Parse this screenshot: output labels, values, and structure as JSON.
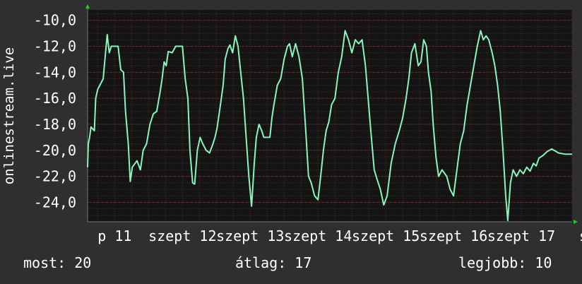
{
  "chart_data": {
    "type": "line",
    "ylabel": "onlinestream.live",
    "ylim": [
      -25.5,
      -9.2
    ],
    "yticks": [
      "-10,0",
      "-12,0",
      "-14,0",
      "-16,0",
      "-18,0",
      "-20,0",
      "-22,0",
      "-24,0"
    ],
    "ytick_values": [
      -10,
      -12,
      -14,
      -16,
      -18,
      -20,
      -22,
      -24
    ],
    "xlim": [
      10.6,
      17.75
    ],
    "xticks": [
      {
        "label": "p 11",
        "value": 11
      },
      {
        "label": "szept 12",
        "value": 12
      },
      {
        "label": "szept 13",
        "value": 13
      },
      {
        "label": "szept 14",
        "value": 14
      },
      {
        "label": "szept 15",
        "value": 15
      },
      {
        "label": "szept 16",
        "value": 16
      },
      {
        "label": "szept 17",
        "value": 17
      },
      {
        "label": "sz",
        "value": 17.98
      }
    ],
    "grid": true,
    "colors": {
      "background": "#2f2f2f",
      "plot": "#141414",
      "line": "#88f5bd",
      "grid": "#4a2d2d",
      "arrow": "#22cc22"
    },
    "series": [
      {
        "values": [
          [
            10.6,
            -21.3
          ],
          [
            10.61,
            -19.5
          ],
          [
            10.63,
            -19.0
          ],
          [
            10.65,
            -18.2
          ],
          [
            10.7,
            -18.5
          ],
          [
            10.72,
            -16.0
          ],
          [
            10.75,
            -15.3
          ],
          [
            10.8,
            -14.8
          ],
          [
            10.83,
            -14.5
          ],
          [
            10.86,
            -12.8
          ],
          [
            10.89,
            -11.1
          ],
          [
            10.92,
            -12.5
          ],
          [
            10.95,
            -12.0
          ],
          [
            11.05,
            -12.0
          ],
          [
            11.09,
            -13.8
          ],
          [
            11.13,
            -14.0
          ],
          [
            11.16,
            -17.0
          ],
          [
            11.2,
            -19.5
          ],
          [
            11.23,
            -22.4
          ],
          [
            11.26,
            -21.3
          ],
          [
            11.3,
            -21.0
          ],
          [
            11.33,
            -20.8
          ],
          [
            11.38,
            -21.5
          ],
          [
            11.42,
            -20.0
          ],
          [
            11.47,
            -19.5
          ],
          [
            11.52,
            -18.0
          ],
          [
            11.57,
            -17.2
          ],
          [
            11.62,
            -17.0
          ],
          [
            11.67,
            -15.5
          ],
          [
            11.7,
            -14.5
          ],
          [
            11.73,
            -13.2
          ],
          [
            11.76,
            -13.5
          ],
          [
            11.79,
            -12.4
          ],
          [
            11.85,
            -12.5
          ],
          [
            11.9,
            -12.0
          ],
          [
            12.0,
            -12.0
          ],
          [
            12.04,
            -14.5
          ],
          [
            12.08,
            -16.0
          ],
          [
            12.11,
            -20.0
          ],
          [
            12.15,
            -22.5
          ],
          [
            12.18,
            -22.6
          ],
          [
            12.22,
            -20.0
          ],
          [
            12.26,
            -19.0
          ],
          [
            12.3,
            -19.5
          ],
          [
            12.35,
            -20.0
          ],
          [
            12.4,
            -20.2
          ],
          [
            12.45,
            -19.5
          ],
          [
            12.48,
            -19.0
          ],
          [
            12.51,
            -18.3
          ],
          [
            12.56,
            -16.5
          ],
          [
            12.6,
            -15.0
          ],
          [
            12.63,
            -13.0
          ],
          [
            12.67,
            -12.2
          ],
          [
            12.7,
            -11.9
          ],
          [
            12.74,
            -12.5
          ],
          [
            12.78,
            -11.2
          ],
          [
            12.82,
            -12.0
          ],
          [
            12.86,
            -14.0
          ],
          [
            12.9,
            -16.0
          ],
          [
            12.94,
            -19.0
          ],
          [
            12.98,
            -22.0
          ],
          [
            13.02,
            -24.3
          ],
          [
            13.06,
            -21.0
          ],
          [
            13.09,
            -19.0
          ],
          [
            13.13,
            -18.0
          ],
          [
            13.17,
            -18.5
          ],
          [
            13.2,
            -19.0
          ],
          [
            13.29,
            -19.0
          ],
          [
            13.32,
            -17.5
          ],
          [
            13.35,
            -16.5
          ],
          [
            13.4,
            -15.0
          ],
          [
            13.45,
            -14.5
          ],
          [
            13.5,
            -13.0
          ],
          [
            13.55,
            -12.0
          ],
          [
            13.58,
            -11.8
          ],
          [
            13.62,
            -12.8
          ],
          [
            13.67,
            -11.8
          ],
          [
            13.72,
            -12.8
          ],
          [
            13.77,
            -14.5
          ],
          [
            13.82,
            -18.5
          ],
          [
            13.86,
            -22.0
          ],
          [
            13.9,
            -22.5
          ],
          [
            13.95,
            -23.5
          ],
          [
            14.0,
            -23.8
          ],
          [
            14.04,
            -22.0
          ],
          [
            14.08,
            -20.0
          ],
          [
            14.12,
            -18.5
          ],
          [
            14.16,
            -17.8
          ],
          [
            14.2,
            -16.5
          ],
          [
            14.25,
            -16.0
          ],
          [
            14.3,
            -14.0
          ],
          [
            14.35,
            -12.8
          ],
          [
            14.4,
            -10.8
          ],
          [
            14.45,
            -11.5
          ],
          [
            14.5,
            -12.5
          ],
          [
            14.55,
            -11.5
          ],
          [
            14.6,
            -11.8
          ],
          [
            14.65,
            -11.5
          ],
          [
            14.7,
            -13.5
          ],
          [
            14.74,
            -16.0
          ],
          [
            14.78,
            -18.5
          ],
          [
            14.83,
            -21.5
          ],
          [
            14.87,
            -22.2
          ],
          [
            14.92,
            -23.0
          ],
          [
            14.97,
            -24.2
          ],
          [
            15.02,
            -23.5
          ],
          [
            15.08,
            -21.0
          ],
          [
            15.14,
            -19.5
          ],
          [
            15.2,
            -18.5
          ],
          [
            15.25,
            -17.5
          ],
          [
            15.3,
            -16.0
          ],
          [
            15.34,
            -14.5
          ],
          [
            15.38,
            -12.5
          ],
          [
            15.43,
            -11.8
          ],
          [
            15.48,
            -13.5
          ],
          [
            15.52,
            -13.2
          ],
          [
            15.56,
            -11.5
          ],
          [
            15.6,
            -12.0
          ],
          [
            15.63,
            -14.0
          ],
          [
            15.67,
            -15.5
          ],
          [
            15.7,
            -18.0
          ],
          [
            15.74,
            -20.5
          ],
          [
            15.78,
            -22.0
          ],
          [
            15.83,
            -21.5
          ],
          [
            15.9,
            -22.0
          ],
          [
            15.95,
            -23.0
          ],
          [
            16.0,
            -23.5
          ],
          [
            16.05,
            -21.5
          ],
          [
            16.1,
            -19.5
          ],
          [
            16.15,
            -18.5
          ],
          [
            16.2,
            -16.5
          ],
          [
            16.25,
            -15.0
          ],
          [
            16.3,
            -13.5
          ],
          [
            16.35,
            -12.0
          ],
          [
            16.4,
            -10.8
          ],
          [
            16.44,
            -11.5
          ],
          [
            16.48,
            -11.2
          ],
          [
            16.52,
            -11.5
          ],
          [
            16.57,
            -12.5
          ],
          [
            16.61,
            -13.5
          ],
          [
            16.65,
            -15.0
          ],
          [
            16.69,
            -17.0
          ],
          [
            16.73,
            -20.0
          ],
          [
            16.77,
            -23.5
          ],
          [
            16.8,
            -25.4
          ],
          [
            16.84,
            -22.5
          ],
          [
            16.88,
            -21.5
          ],
          [
            16.93,
            -22.0
          ],
          [
            16.98,
            -21.5
          ],
          [
            17.03,
            -21.8
          ],
          [
            17.08,
            -21.3
          ],
          [
            17.13,
            -21.6
          ],
          [
            17.18,
            -21.0
          ],
          [
            17.22,
            -21.2
          ],
          [
            17.26,
            -20.6
          ],
          [
            17.32,
            -20.4
          ],
          [
            17.38,
            -20.1
          ],
          [
            17.45,
            -19.9
          ],
          [
            17.55,
            -20.2
          ],
          [
            17.65,
            -20.3
          ],
          [
            17.75,
            -20.3
          ]
        ]
      }
    ]
  },
  "stats": {
    "now_label": "most:",
    "now_value": "20",
    "avg_label": "átlag:",
    "avg_value": "17",
    "best_label": "legjobb:",
    "best_value": "10"
  }
}
